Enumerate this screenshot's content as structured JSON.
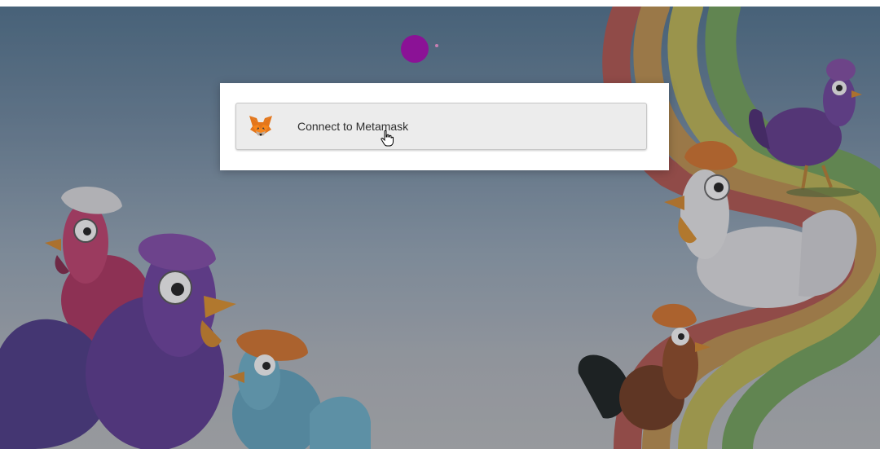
{
  "modal": {
    "connect_label": "Connect to Metamask",
    "icon": "metamask-fox-icon"
  },
  "background": {
    "logo": "purple-dot-logo",
    "illustration": "cartoon-roosters-and-rainbow"
  },
  "cursor": {
    "icon": "hand-pointer-cursor"
  },
  "colors": {
    "logo_purple": "#8b1296",
    "button_bg": "#ececec",
    "modal_bg": "#ffffff"
  }
}
